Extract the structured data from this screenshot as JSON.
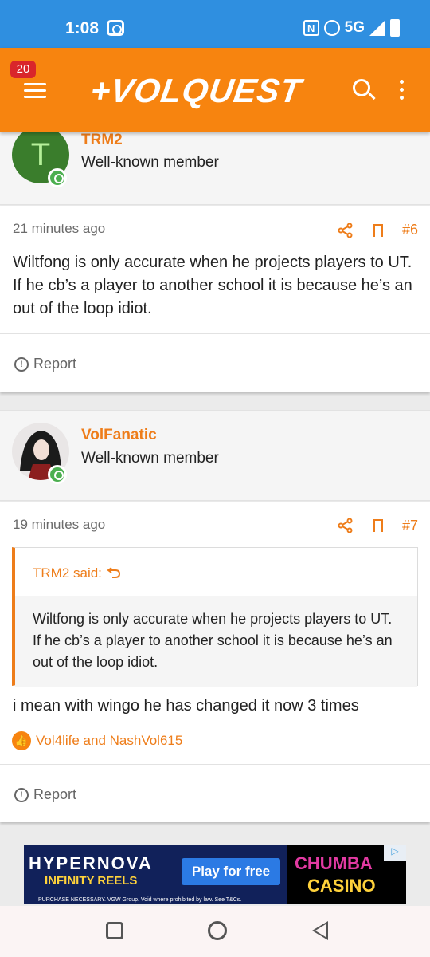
{
  "status_bar": {
    "time": "1:08",
    "network": "5G",
    "nfc": "N"
  },
  "header": {
    "notification_count": "20",
    "logo_text": "+VOLQUEST"
  },
  "posts": [
    {
      "author": "TRM2",
      "avatar_letter": "T",
      "avatar_color": "#3a7d2c",
      "user_title": "Well-known member",
      "time": "21 minutes ago",
      "post_number": "#6",
      "body": "Wiltfong is only accurate when he projects players to UT. If he cb’s a player to another school it is because he’s an out of the loop idiot.",
      "report_label": "Report"
    },
    {
      "author": "VolFanatic",
      "user_title": "Well-known member",
      "time": "19 minutes ago",
      "post_number": "#7",
      "quote": {
        "author": "TRM2 said:",
        "body": "Wiltfong is only accurate when he projects players to UT. If he cb’s a player to another school it is because he’s an out of the loop idiot."
      },
      "body": "i mean with wingo he has changed it now 3 times",
      "reactions": "Vol4life and NashVol615",
      "report_label": "Report"
    }
  ],
  "ad": {
    "brand": "HYPERNOVA",
    "brand_sub": "INFINITY REELS",
    "cta": "Play for free",
    "casino_line1": "CHUMBA",
    "casino_line2": "CASINO",
    "fine_print": "PURCHASE NECESSARY. VGW Group. Void where prohibited by law. See T&Cs."
  },
  "colors": {
    "accent": "#f7840f",
    "status_bar": "#2f8fe0",
    "link": "#ee7d1a"
  }
}
